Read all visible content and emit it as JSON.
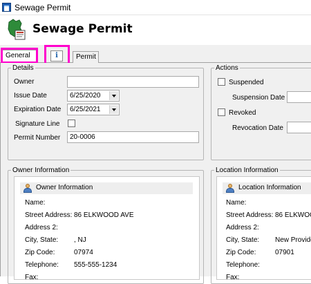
{
  "window": {
    "title": "Sewage Permit",
    "icon": "app-window-icon"
  },
  "header": {
    "title": "Sewage Permit",
    "logo": "permit-logo-icon"
  },
  "tabs": [
    {
      "label": "General",
      "active": true
    },
    {
      "label": "i",
      "icon": "info-icon"
    },
    {
      "label": "Permit"
    }
  ],
  "details": {
    "legend": "Details",
    "owner_label": "Owner",
    "owner_value": "",
    "issue_date_label": "Issue Date",
    "issue_date_value": "6/25/2020",
    "expiration_date_label": "Expiration Date",
    "expiration_date_value": "6/25/2021",
    "signature_line_label": "Signature Line",
    "signature_line_checked": false,
    "permit_number_label": "Permit Number",
    "permit_number_value": "20-0006"
  },
  "actions": {
    "legend": "Actions",
    "suspended_label": "Suspended",
    "suspended_checked": false,
    "suspension_date_label": "Suspension Date",
    "suspension_date_value": "",
    "revoked_label": "Revoked",
    "revoked_checked": false,
    "revocation_date_label": "Revocation Date",
    "revocation_date_value": ""
  },
  "owner_info": {
    "legend": "Owner Information",
    "card_title": "Owner Information",
    "name_label": "Name:",
    "name_value": "",
    "street_label": "Street Address:",
    "street_value": "86 ELKWOOD AVE",
    "address2_label": "Address 2:",
    "address2_value": "",
    "city_label": "City, State:",
    "city_value": ", NJ",
    "zip_label": "Zip Code:",
    "zip_value": "07974",
    "phone_label": "Telephone:",
    "phone_value": "555-555-1234",
    "fax_label": "Fax:",
    "fax_value": ""
  },
  "location_info": {
    "legend": "Location Information",
    "card_title": "Location Information",
    "name_label": "Name:",
    "name_value": "",
    "street_label": "Street Address:",
    "street_value": "86 ELKWOO",
    "address2_label": "Address 2:",
    "address2_value": "",
    "city_label": "City, State:",
    "city_value": "New Provide",
    "zip_label": "Zip Code:",
    "zip_value": "07901",
    "phone_label": "Telephone:",
    "phone_value": "",
    "fax_label": "Fax:",
    "fax_value": ""
  },
  "colors": {
    "highlight": "#ff00cc",
    "panel_background": "#f0f0f0",
    "accent_blue": "#1f5fb4"
  }
}
